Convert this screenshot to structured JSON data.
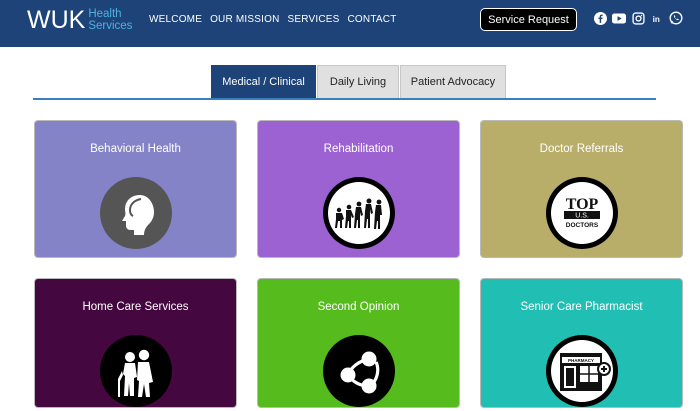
{
  "header": {
    "logo_mark": "WUK",
    "logo_sub_1": "Health",
    "logo_sub_2": "Services",
    "nav": [
      "WELCOME",
      "OUR MISSION",
      "SERVICES",
      "CONTACT"
    ],
    "cta_label": "Service Request",
    "social_icons": [
      "facebook-icon",
      "youtube-icon",
      "instagram-icon",
      "linkedin-icon",
      "whatsapp-icon"
    ]
  },
  "tabs": [
    {
      "label": "Medical / Clinical",
      "active": true
    },
    {
      "label": "Daily Living",
      "active": false
    },
    {
      "label": "Patient Advocacy",
      "active": false
    }
  ],
  "cards": [
    {
      "title": "Behavioral Health",
      "color": "#8583c7",
      "icon": "head-profile-icon"
    },
    {
      "title": "Rehabilitation",
      "color": "#9d62d1",
      "icon": "walking-evolution-icon"
    },
    {
      "title": "Doctor Referrals",
      "color": "#b9ad6a",
      "icon": "top-us-doctors-icon",
      "icon_text_1": "TOP",
      "icon_text_2": "U.S.",
      "icon_text_3": "DOCTORS"
    },
    {
      "title": "Home Care Services",
      "color": "#45073f",
      "icon": "elderly-couple-icon"
    },
    {
      "title": "Second Opinion",
      "color": "#56bb1d",
      "icon": "share-nodes-icon"
    },
    {
      "title": "Senior Care Pharmacist",
      "color": "#21bfb3",
      "icon": "pharmacy-storefront-icon",
      "icon_text_1": "PHARMACY"
    }
  ],
  "colors": {
    "header_bg": "#1d4378",
    "accent_blue": "#3a7fc0",
    "logo_sub": "#4fb3e0"
  }
}
